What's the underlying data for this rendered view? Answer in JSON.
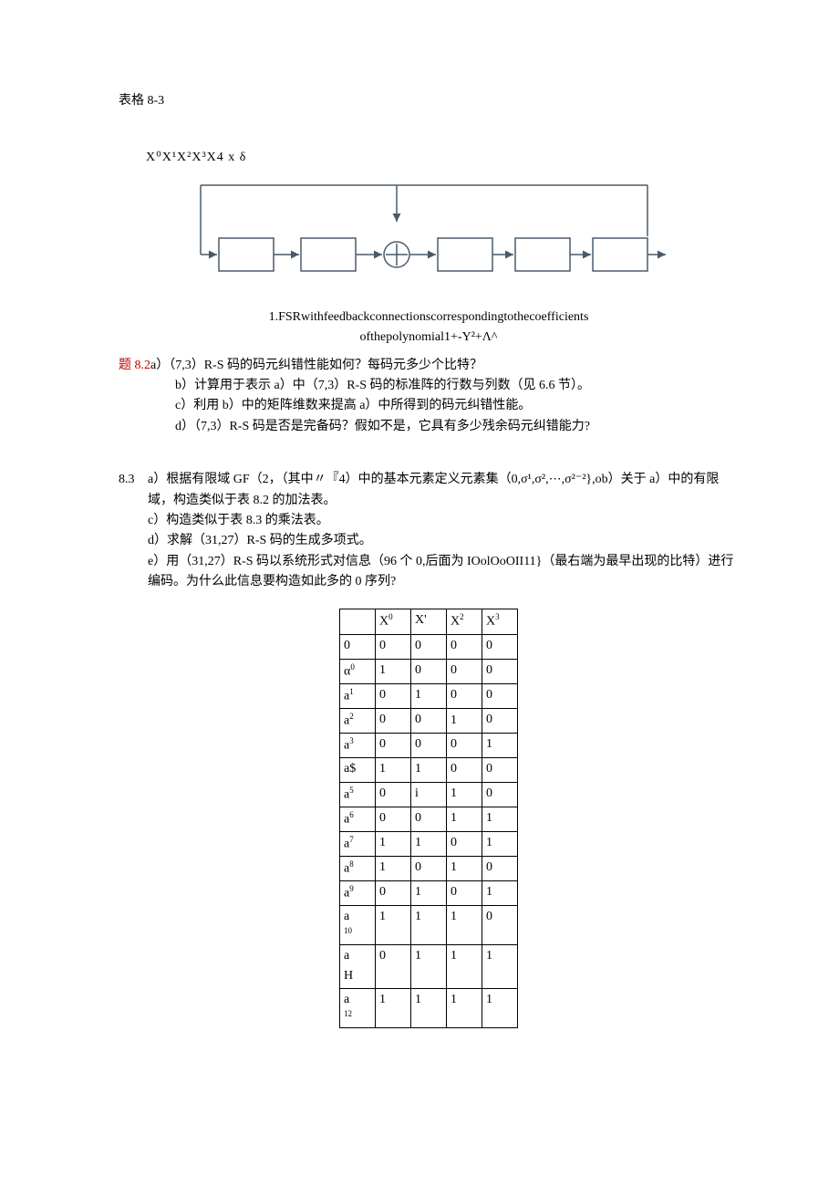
{
  "tableLabel": "表格 8-3",
  "polyLine": "X⁰X¹X²X³X4 x  δ",
  "caption_line1": "1.FSRwithfeedbackconnectionscorrespondingtothecoefficients",
  "caption_line2": "ofthepolynomial1+-Y²+Λ^",
  "p82": {
    "num": "题 8.2",
    "a": "a）（7,3）R-S 码的码元纠错性能如何？每码元多少个比特？",
    "b": "b）计算用于表示 a）中（7,3）R-S 码的标准阵的行数与列数（见 6.6 节）。",
    "c": "c）利用 b）中的矩阵维数来提高 a）中所得到的码元纠错性能。",
    "d": "d）（7,3）R-S 码是否是完备码？假如不是，它具有多少残余码元纠错能力?"
  },
  "p83": {
    "num": "8.3",
    "a": "a）根据有限域 GF（2，（其中〃『4）中的基本元素定义元素集（0,σ¹,σ²,⋯,σ²⁻²},ob）关于 a）中的有限域，构造类似于表 8.2 的加法表。",
    "c": "c）构造类似于表 8.3 的乘法表。",
    "d": "d）求解（31,27）R-S 码的生成多项式。",
    "e": "e）用（31,27）R-S 码以系统形式对信息（96 个 0,后面为 IOolOoOII11}（最右端为最早出现的比特）进行编码。为什么此信息要构造如此多的 0 序列?"
  },
  "headers": [
    "",
    "X⁰",
    "X'",
    "X²",
    "X³"
  ],
  "rows": [
    {
      "lbl_html": "0",
      "v": [
        "0",
        "0",
        "0",
        "0"
      ]
    },
    {
      "lbl_html": "α<sup>0</sup>",
      "v": [
        "1",
        "0",
        "0",
        "0"
      ]
    },
    {
      "lbl_html": "a<sup>1</sup>",
      "v": [
        "0",
        "1",
        "0",
        "0"
      ]
    },
    {
      "lbl_html": "a<sup>2</sup>",
      "v": [
        "0",
        "0",
        "1",
        "0"
      ],
      "shift2": true
    },
    {
      "lbl_html": "a<sup>3</sup>",
      "v": [
        "0",
        "0",
        "0",
        "1"
      ]
    },
    {
      "lbl_html": "a$",
      "v": [
        "1",
        "1",
        "0",
        "0"
      ]
    },
    {
      "lbl_html": "a<sup>5</sup>",
      "v": [
        "0",
        "i",
        "1",
        "0"
      ]
    },
    {
      "lbl_html": "a<sup>6</sup>",
      "v": [
        "0",
        "0",
        "1",
        "1"
      ]
    },
    {
      "lbl_html": "a<sup>7</sup>",
      "v": [
        "1",
        "1",
        "0",
        "1"
      ]
    },
    {
      "lbl_html": "a<sup>8</sup>",
      "v": [
        "1",
        "0",
        "1",
        "0"
      ]
    },
    {
      "lbl_html": "a<sup>9</sup>",
      "v": [
        "0",
        "1",
        "0",
        "1"
      ]
    },
    {
      "lbl_html": "a<span class=\"sub\">10</span>",
      "v": [
        "1",
        "1",
        "1",
        "0"
      ],
      "tall": true
    },
    {
      "lbl_html": "a<br>H",
      "v": [
        "0",
        "1",
        "1",
        "1"
      ],
      "tall": true
    },
    {
      "lbl_html": "a<span class=\"sub\">12</span>",
      "v": [
        "1",
        "1",
        "1",
        "1"
      ],
      "tall": true
    }
  ]
}
